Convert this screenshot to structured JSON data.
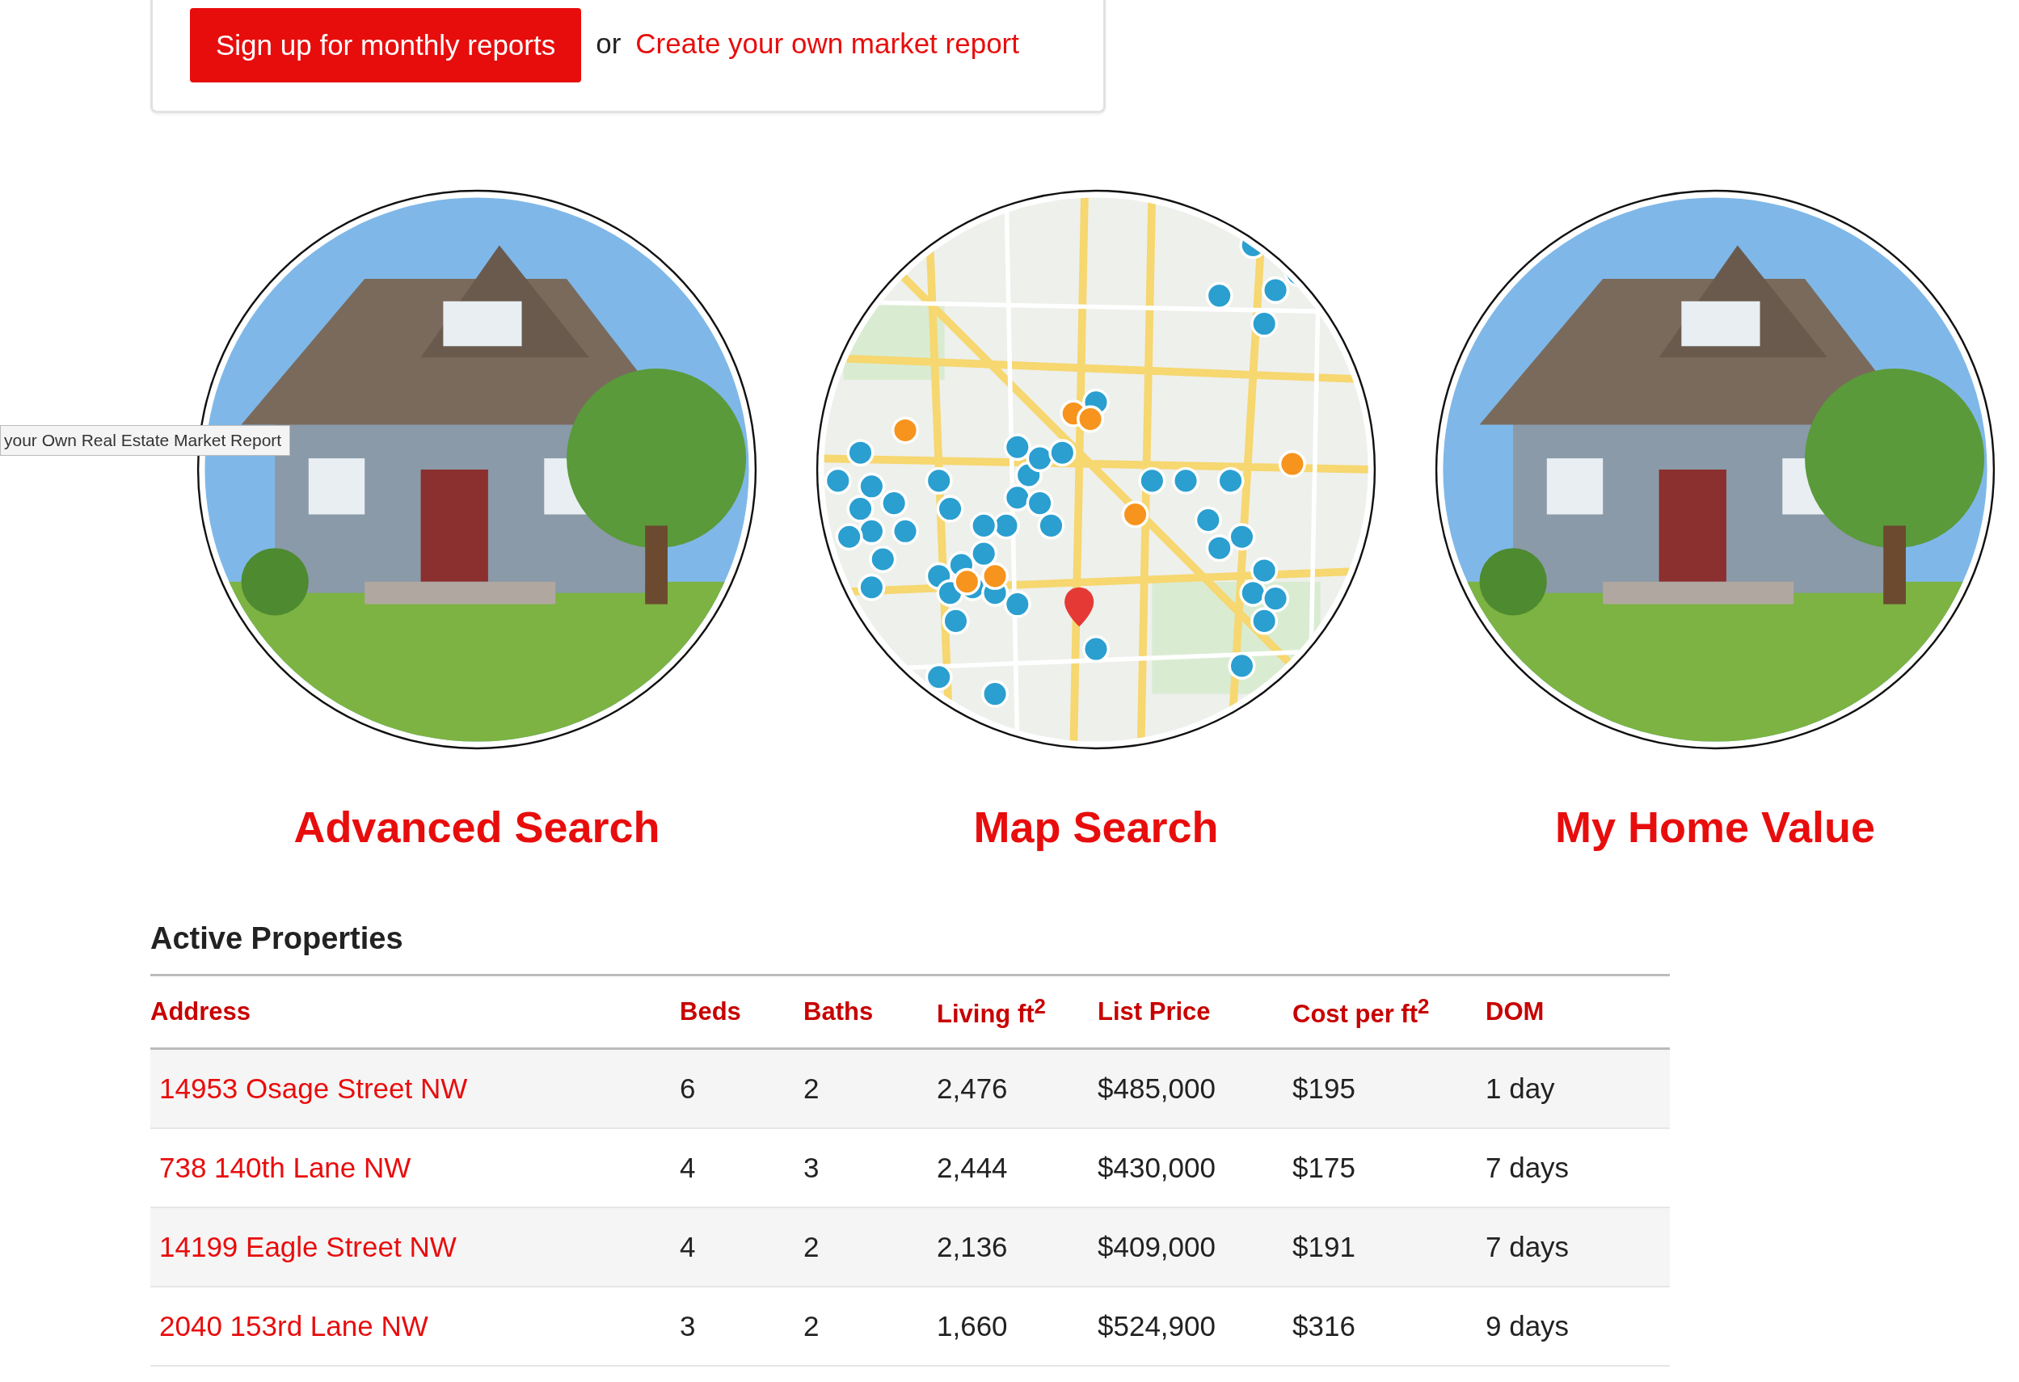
{
  "report_card": {
    "signup_button": "Sign up for monthly reports",
    "or_text": "or",
    "create_link": "Create your own market report"
  },
  "tooltip": "your Own Real Estate Market Report",
  "features": [
    {
      "kind": "photo",
      "title": "Advanced Search"
    },
    {
      "kind": "map",
      "title": "Map Search"
    },
    {
      "kind": "photo",
      "title": "My Home Value"
    }
  ],
  "table": {
    "title": "Active Properties",
    "columns": [
      "Address",
      "Beds",
      "Baths",
      "Living ft$^{2}$",
      "List Price",
      "Cost per ft$^{2}$",
      "DOM"
    ],
    "rows": [
      [
        "14953 Osage Street NW",
        "6",
        "2",
        "2,476",
        "$485,000",
        "$195",
        "1 day"
      ],
      [
        "738 140th Lane NW",
        "4",
        "3",
        "2,444",
        "$430,000",
        "$175",
        "7 days"
      ],
      [
        "14199 Eagle Street NW",
        "4",
        "2",
        "2,136",
        "$409,000",
        "$191",
        "7 days"
      ],
      [
        "2040 153rd Lane NW",
        "3",
        "2",
        "1,660",
        "$524,900",
        "$316",
        "9 days"
      ]
    ]
  }
}
